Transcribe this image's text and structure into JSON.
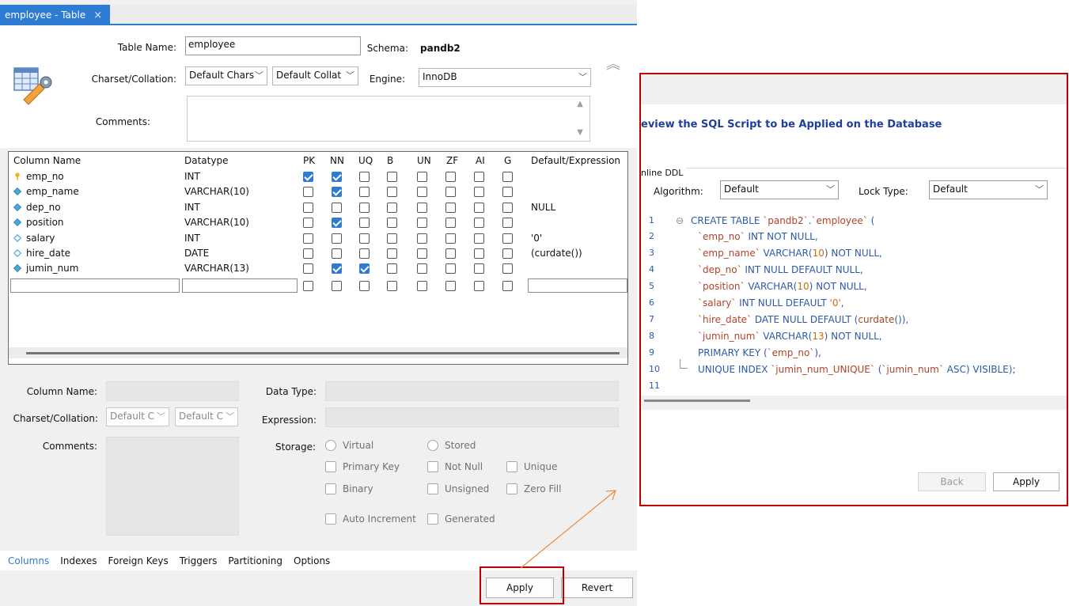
{
  "tab": {
    "title": "employee - Table",
    "close": "×"
  },
  "form": {
    "table_name_label": "Table Name:",
    "table_name_value": "employee",
    "schema_label": "Schema:",
    "schema_value": "pandb2",
    "charset_label": "Charset/Collation:",
    "charset_value": "Default Chars",
    "collation_value": "Default Collat",
    "engine_label": "Engine:",
    "engine_value": "InnoDB",
    "comments_label": "Comments:"
  },
  "grid": {
    "headers": [
      "Column Name",
      "Datatype",
      "PK",
      "NN",
      "UQ",
      "B",
      "UN",
      "ZF",
      "AI",
      "G",
      "Default/Expression"
    ],
    "rows": [
      {
        "name": "emp_no",
        "type": "INT",
        "icon": "key-icon",
        "pk": true,
        "nn": true,
        "uq": false,
        "default": ""
      },
      {
        "name": "emp_name",
        "type": "VARCHAR(10)",
        "icon": "diamond-filled-icon",
        "pk": false,
        "nn": true,
        "uq": false,
        "default": ""
      },
      {
        "name": "dep_no",
        "type": "INT",
        "icon": "diamond-filled-icon",
        "pk": false,
        "nn": false,
        "uq": false,
        "default": "NULL"
      },
      {
        "name": "position",
        "type": "VARCHAR(10)",
        "icon": "diamond-filled-icon",
        "pk": false,
        "nn": true,
        "uq": false,
        "default": ""
      },
      {
        "name": "salary",
        "type": "INT",
        "icon": "diamond-outline-icon",
        "pk": false,
        "nn": false,
        "uq": false,
        "default": "'0'"
      },
      {
        "name": "hire_date",
        "type": "DATE",
        "icon": "diamond-outline-icon",
        "pk": false,
        "nn": false,
        "uq": false,
        "default": "(curdate())"
      },
      {
        "name": "jumin_num",
        "type": "VARCHAR(13)",
        "icon": "diamond-filled-icon",
        "pk": false,
        "nn": true,
        "uq": true,
        "default": ""
      }
    ]
  },
  "detail": {
    "column_name_label": "Column Name:",
    "data_type_label": "Data Type:",
    "charset_label": "Charset/Collation:",
    "charset_value": "Default C",
    "collation_value": "Default C",
    "expression_label": "Expression:",
    "comments_label": "Comments:",
    "storage_label": "Storage:",
    "virtual": "Virtual",
    "stored": "Stored",
    "primary_key": "Primary Key",
    "not_null": "Not Null",
    "unique": "Unique",
    "binary": "Binary",
    "unsigned": "Unsigned",
    "zero_fill": "Zero Fill",
    "auto_increment": "Auto Increment",
    "generated": "Generated"
  },
  "bottom_tabs": [
    "Columns",
    "Indexes",
    "Foreign Keys",
    "Triggers",
    "Partitioning",
    "Options"
  ],
  "buttons": {
    "apply": "Apply",
    "revert": "Revert"
  },
  "review": {
    "title": "eview the SQL Script to be Applied on the Database",
    "online_ddl": "nline DDL",
    "algorithm_label": "Algorithm:",
    "algorithm_value": "Default",
    "lock_label": "Lock Type:",
    "lock_value": "Default",
    "line_numbers": [
      "1",
      "2",
      "3",
      "4",
      "5",
      "6",
      "7",
      "8",
      "9",
      "10",
      "11"
    ],
    "back": "Back",
    "apply": "Apply"
  },
  "colors": {
    "accent": "#2d7bd3",
    "highlight": "#c00000",
    "arrow": "#f08a3c"
  }
}
